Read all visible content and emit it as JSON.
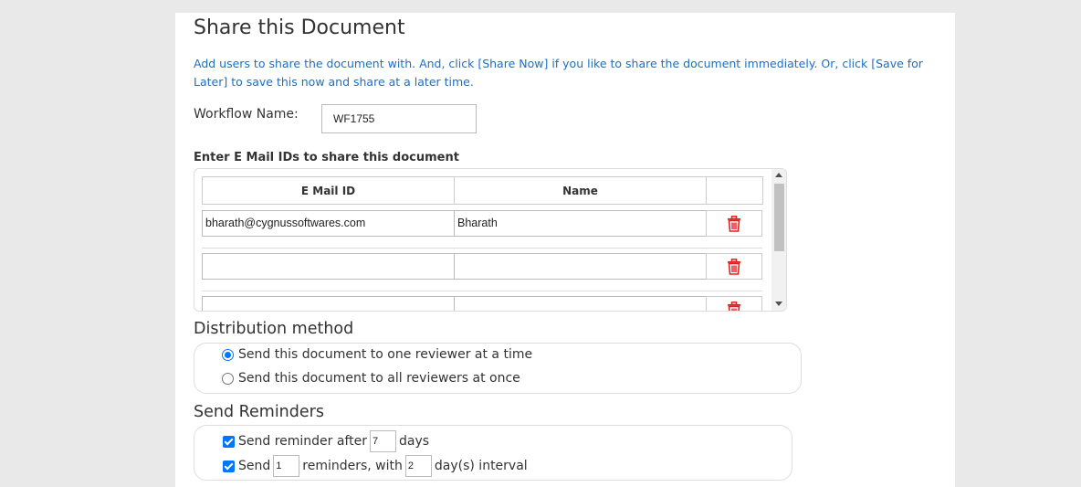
{
  "page": {
    "title": "Share this Document",
    "info": "Add users to share the document with. And, click [Share Now] if you like to share the document immediately. Or, click [Save for Later] to save this now and share at a later time."
  },
  "workflow": {
    "label": "Workflow Name:",
    "value": "WF1755"
  },
  "email_section": {
    "heading": "Enter E Mail IDs to share this document",
    "columns": [
      "E Mail ID",
      "Name",
      ""
    ],
    "rows": [
      {
        "email": "bharath@cygnussoftwares.com",
        "name": "Bharath"
      },
      {
        "email": "",
        "name": ""
      },
      {
        "email": "",
        "name": ""
      }
    ],
    "delete_icon_name": "trash-icon",
    "delete_icon_color": "#e02020"
  },
  "distribution": {
    "title": "Distribution method",
    "options": [
      {
        "label": "Send this document to one reviewer at a time",
        "selected": true
      },
      {
        "label": "Send this document to all reviewers at once",
        "selected": false
      }
    ]
  },
  "reminders": {
    "title": "Send Reminders",
    "row1": {
      "prefix": "Send reminder after",
      "value": "7",
      "suffix": "days",
      "checked": true
    },
    "row2": {
      "prefix": "Send",
      "count": "1",
      "middle": "reminders, with",
      "interval": "2",
      "suffix": "day(s) interval",
      "checked": true
    }
  },
  "colors": {
    "accent": "#0075ff",
    "info_text": "#1a6fc9",
    "panel_bg": "#ffffff",
    "page_bg": "#e9e9e9"
  }
}
